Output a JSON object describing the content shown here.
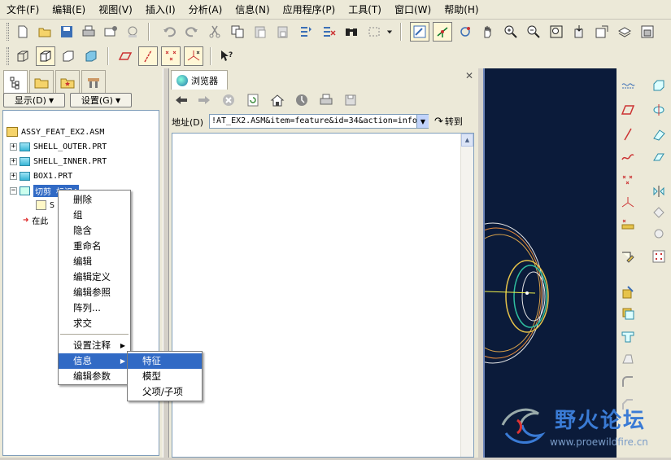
{
  "menubar": [
    {
      "label": "文件(F)"
    },
    {
      "label": "编辑(E)"
    },
    {
      "label": "视图(V)"
    },
    {
      "label": "插入(I)"
    },
    {
      "label": "分析(A)"
    },
    {
      "label": "信息(N)"
    },
    {
      "label": "应用程序(P)"
    },
    {
      "label": "工具(T)"
    },
    {
      "label": "窗口(W)"
    },
    {
      "label": "帮助(H)"
    }
  ],
  "left_panel": {
    "show_button": "显示(D)",
    "settings_button": "设置(G)",
    "tree": {
      "root": "ASSY_FEAT_EX2.ASM",
      "items": [
        "SHELL_OUTER.PRT",
        "SHELL_INNER.PRT",
        "BOX1.PRT"
      ],
      "selected": "切剪 标识4",
      "child": "S",
      "insert_here": "在此"
    }
  },
  "browser": {
    "tab_label": "浏览器",
    "address_label": "地址(D)",
    "address_value": "!AT_EX2.ASM&item=feature&id=34&action=info",
    "go_label": "转到"
  },
  "context_menu": {
    "items": [
      "删除",
      "组",
      "隐含",
      "重命名",
      "编辑",
      "编辑定义",
      "编辑参照",
      "阵列...",
      "求交"
    ],
    "items2": [
      "设置注释",
      "信息",
      "编辑参数"
    ],
    "highlighted": "信息"
  },
  "submenu": {
    "items": [
      "特征",
      "模型",
      "父项/子项"
    ],
    "highlighted": "特征"
  },
  "watermark": {
    "text": "野火论坛",
    "url": "www.proewildfire.cn"
  },
  "colors": {
    "selection": "#316ac5",
    "graphics_bg": "#0b1b3a"
  }
}
